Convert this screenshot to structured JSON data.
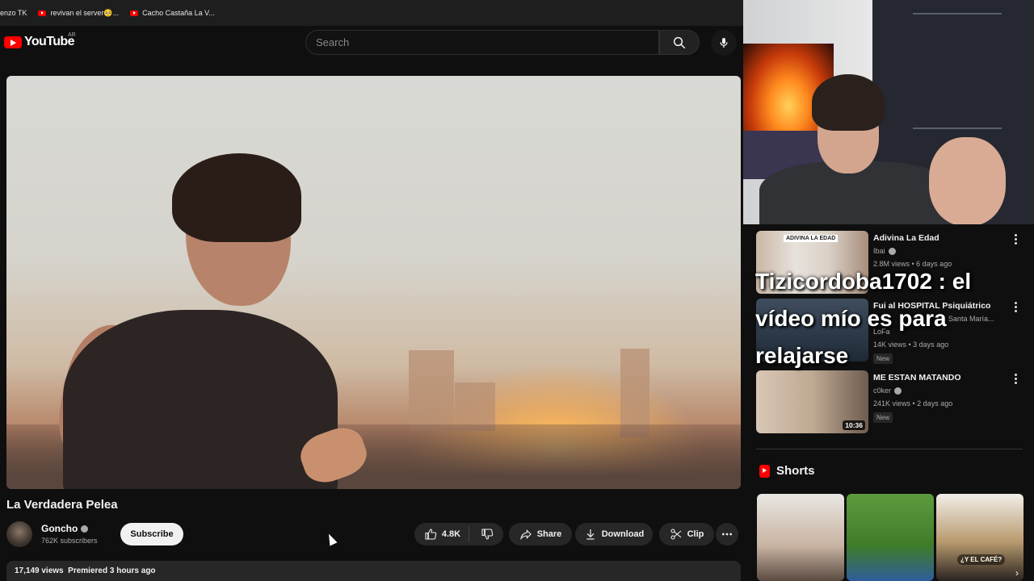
{
  "bookmarks": [
    {
      "label": "enzo TK"
    },
    {
      "label": "revivan el server🥺..."
    },
    {
      "label": "Cacho Castaña La V..."
    }
  ],
  "masthead": {
    "logo_text": "YouTube",
    "region": "AR",
    "search_placeholder": "Search"
  },
  "video": {
    "title": "La Verdadera Pelea",
    "channel": "Goncho",
    "subscribers": "762K subscribers",
    "subscribe_label": "Subscribe",
    "likes": "4.8K",
    "share_label": "Share",
    "download_label": "Download",
    "clip_label": "Clip",
    "views": "17,149 views",
    "premiered": "Premiered 3 hours ago"
  },
  "recommendations": [
    {
      "title": "Adivina La Edad",
      "channel": "Ibai",
      "verified": true,
      "meta": "2.8M views • 6 days ago",
      "thumb_text": "ADIVINA LA EDAD"
    },
    {
      "title": "Fui al HOSPITAL Psiquiátrico",
      "subtitle": "Santa María...",
      "channel": "LoFa",
      "meta": "14K views • 3 days ago",
      "badge": "New"
    },
    {
      "title": "ME ESTAN MATANDO",
      "channel": "c0ker",
      "verified": true,
      "meta": "241K views • 2 days ago",
      "badge": "New",
      "duration": "10:36"
    }
  ],
  "chat_overlay": "Tizicordoba1702 : el vídeo mío es para relajarse",
  "shorts": {
    "heading": "Shorts",
    "items": [
      {
        "caption": ""
      },
      {
        "caption": ""
      },
      {
        "caption": "¿Y EL CAFÉ?"
      }
    ]
  },
  "colors": {
    "accent": "#ff0000",
    "background": "#0f0f0f",
    "pill": "#272727"
  }
}
